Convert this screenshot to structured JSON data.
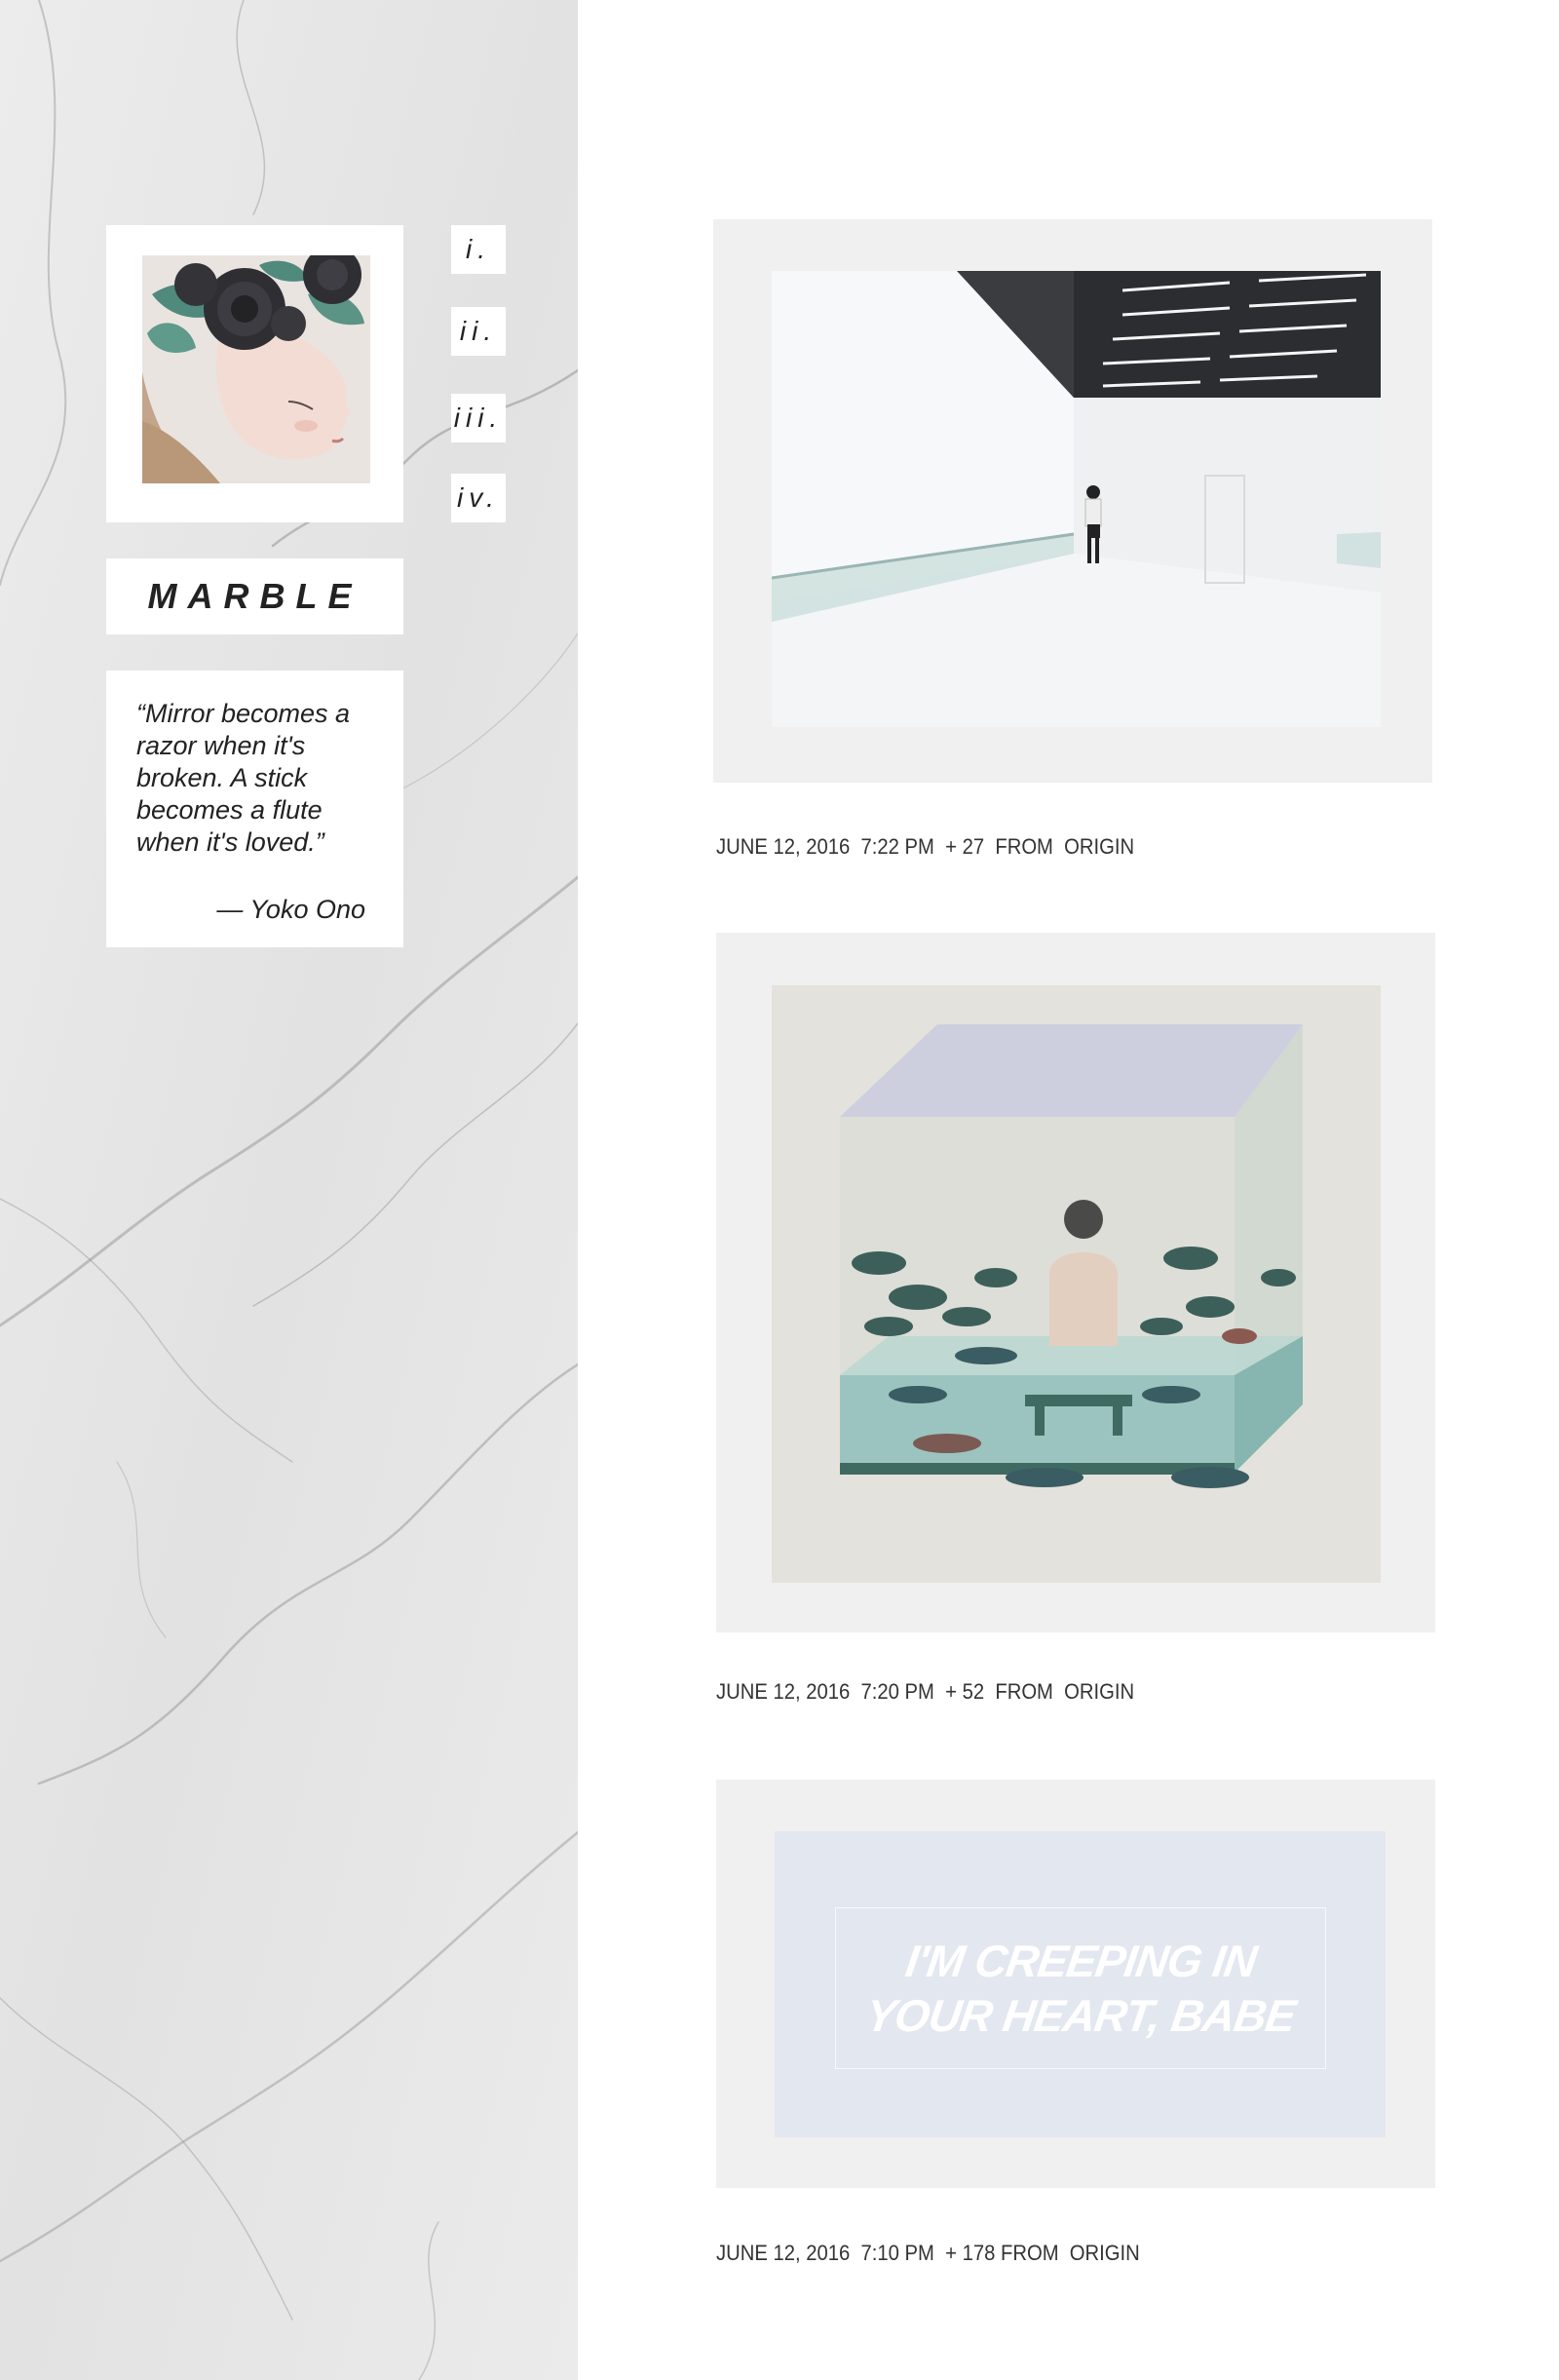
{
  "sidebar": {
    "brand": "MARBLE",
    "nav": [
      {
        "label": "i."
      },
      {
        "label": "ii."
      },
      {
        "label": "iii."
      },
      {
        "label": "iv."
      }
    ],
    "quote": {
      "text": "“Mirror becomes a razor when it's broken. A stick becomes a flute when it's loved.”",
      "author": "— Yoko Ono"
    }
  },
  "posts": [
    {
      "meta": "JUNE 12, 2016  7:22 PM  + 27  FROM  ORIGIN"
    },
    {
      "meta": "JUNE 12, 2016  7:20 PM  + 52  FROM  ORIGIN"
    },
    {
      "meta": "JUNE 12, 2016  7:10 PM  + 178 FROM  ORIGIN",
      "card_lines": [
        "I'M CREEPING IN",
        "YOUR HEART, BABE"
      ]
    }
  ],
  "colors": {
    "frame": "#f0f0f0",
    "marble": "#e6e6e6",
    "card_bg": "#e2e7f0"
  },
  "icons": [
    "marble-texture",
    "portrait-illustration",
    "white-hall-photo",
    "aquarium-painting"
  ]
}
